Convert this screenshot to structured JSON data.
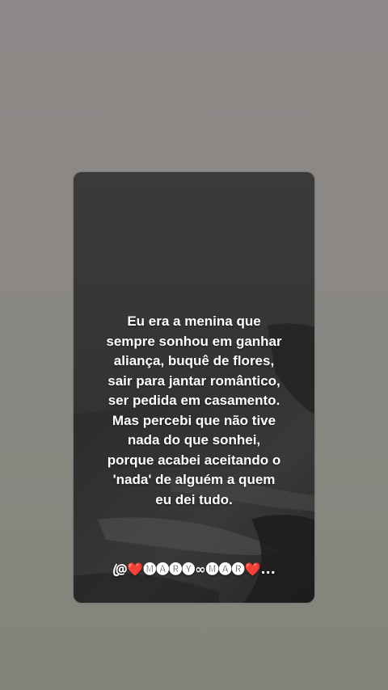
{
  "card": {
    "quote_lines": [
      "Eu era a menina que",
      "sempre sonhou em ganhar",
      "aliança, buquê de flores,",
      "sair para jantar romântico,",
      "ser pedida em casamento.",
      "Mas percebi que não tive",
      "nada do que sonhei,",
      "porque acabei aceitando o",
      "'nada' de alguém a quem",
      "eu dei tudo."
    ],
    "signature": "@ꦿ❤️🅜🅐🅡🅨∞🅜🅐🅡❤️..."
  },
  "colors": {
    "background": "#8b8885",
    "card": "#2f2f2f",
    "text": "#ffffff"
  }
}
